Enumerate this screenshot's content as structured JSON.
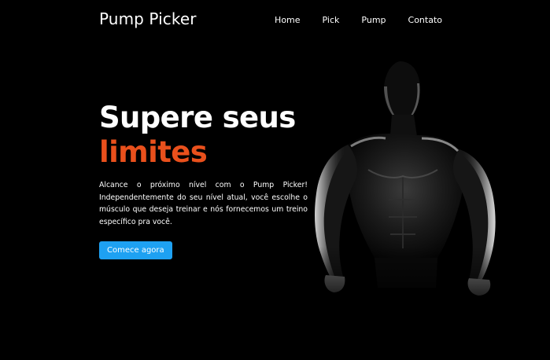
{
  "header": {
    "brand": "Pump Picker",
    "nav": [
      "Home",
      "Pick",
      "Pump",
      "Contato"
    ]
  },
  "hero": {
    "title_line1": "Supere seus",
    "title_line2": "limites",
    "description": "Alcance o próximo nível com o Pump Picker! Independentemente do seu nível atual, você escolhe o músculo que deseja treinar e nós fornecemos um treino específico pra você.",
    "cta_label": "Comece agora",
    "image_icon": "muscular-man-silhouette"
  },
  "colors": {
    "background": "#000000",
    "accent": "#e9501c",
    "button": "#1ea1f2",
    "text": "#ffffff"
  }
}
